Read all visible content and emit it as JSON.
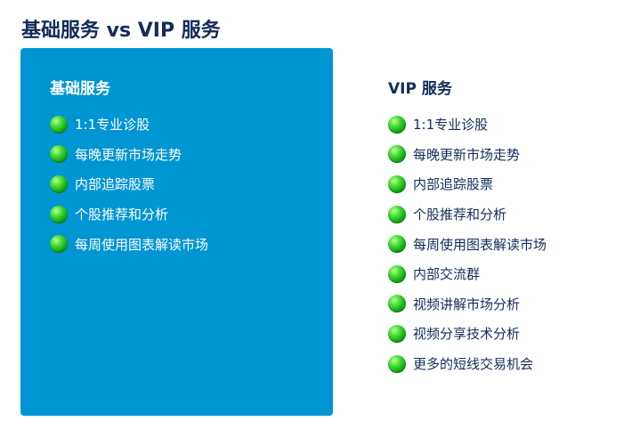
{
  "title": "基础服务 vs VIP 服务",
  "colors": {
    "basic_panel_bg": "#0095d3",
    "title_text": "#142c5a",
    "check_dot": "#1fbf22"
  },
  "icons": {
    "bullet": "green-dot-icon"
  },
  "basic": {
    "title": "基础服务",
    "items": [
      "1:1专业诊股",
      "每晚更新市场走势",
      "内部追踪股票",
      "个股推荐和分析",
      "每周使用图表解读市场"
    ]
  },
  "vip": {
    "title": "VIP 服务",
    "items": [
      "1:1专业诊股",
      "每晚更新市场走势",
      "内部追踪股票",
      "个股推荐和分析",
      "每周使用图表解读市场",
      "内部交流群",
      "视频讲解市场分析",
      "视频分享技术分析",
      "更多的短线交易机会"
    ]
  }
}
